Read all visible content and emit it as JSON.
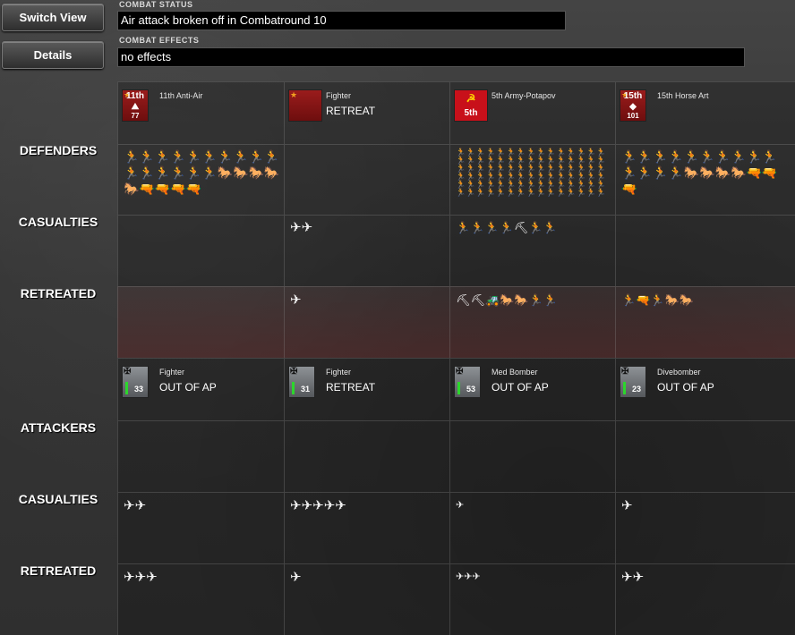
{
  "buttons": {
    "switch_view": "Switch View",
    "details": "Details"
  },
  "combat_status": {
    "label": "COMBAT STATUS",
    "value": "Air attack broken off in Combatround  10"
  },
  "combat_effects": {
    "label": "COMBAT EFFECTS",
    "value": "no effects"
  },
  "row_labels": {
    "defenders": "DEFENDERS",
    "def_casualties": "CASUALTIES",
    "def_retreated": "RETREATED",
    "attackers": "ATTACKERS",
    "att_casualties": "CASUALTIES",
    "att_retreated": "RETREATED"
  },
  "defenders": [
    {
      "name": "11th Anti-Air",
      "status": "",
      "icon_top": "11th",
      "icon_num": "77",
      "flag": "sov",
      "troops": "🏃🏃🏃🏃🏃🏃🏃🏃🏃🏃🏃🏃🏃🏃🏃🏃🐎🐎🐎🐎🐎🔫🔫🔫🔫",
      "casualties": "",
      "retreated": ""
    },
    {
      "name": "Fighter",
      "status": "RETREAT",
      "icon_top": "",
      "icon_num": "",
      "flag": "sov",
      "troops": "",
      "casualties": "✈✈",
      "retreated": "✈"
    },
    {
      "name": "5th Army-Potapov",
      "status": "",
      "icon_top": "5th",
      "icon_num": "",
      "flag": "sov",
      "troops": "🏃🏃🏃🏃🏃🏃🏃🏃🏃🏃🏃🏃🏃🏃🏃🏃🏃🏃🏃🏃🏃🏃🏃🏃🏃🏃🏃🏃🏃🏃🏃🏃🏃🏃🏃🏃🏃🏃🏃🏃🏃🏃🏃🏃🏃🏃🏃🏃🏃🏃🏃🏃🏃🏃🏃🏃🏃🏃🏃🏃🏃🏃🏃🏃🏃🏃🏃🏃🏃🏃🏃🏃🏃🏃🏃🏃🏃🏃🏃🏃🏃🏃🏃🏃🏃🏃🏃🏃🏃🏃",
      "casualties": "🏃🏃🏃🏃⛏🏃🏃",
      "retreated": "⛏⛏🚜🐎🐎🏃🏃"
    },
    {
      "name": "15th Horse Art",
      "status": "",
      "icon_top": "15th",
      "icon_num": "101",
      "flag": "sov",
      "troops": "🏃🏃🏃🏃🏃🏃🏃🏃🏃🏃🏃🏃🏃🏃🐎🐎🐎🐎🔫🔫🔫",
      "casualties": "",
      "retreated": "🏃🔫🏃🐎🐎"
    }
  ],
  "attackers": [
    {
      "name": "Fighter",
      "status": "OUT OF AP",
      "icon_num": "33",
      "flag": "ger",
      "casualties": "✈✈",
      "retreated": "✈✈✈"
    },
    {
      "name": "Fighter",
      "status": "RETREAT",
      "icon_num": "31",
      "flag": "ger",
      "casualties": "✈✈✈✈✈",
      "retreated": "✈"
    },
    {
      "name": "Med Bomber",
      "status": "OUT OF AP",
      "icon_num": "53",
      "flag": "ger",
      "casualties": "✈",
      "retreated": "✈✈✈"
    },
    {
      "name": "Divebomber",
      "status": "OUT OF AP",
      "icon_num": "23",
      "flag": "ger",
      "casualties": "✈",
      "retreated": "✈✈"
    }
  ],
  "icons": {
    "soviet": "soviet-star-icon",
    "german": "balkenkreuz-icon",
    "plane": "plane-icon",
    "soldier": "soldier-icon"
  },
  "colors": {
    "soviet_red": "#9a1c1c",
    "german_gray": "#8e9296",
    "ap_green": "#2cd62c",
    "retreat_tint": "#5a2626"
  }
}
